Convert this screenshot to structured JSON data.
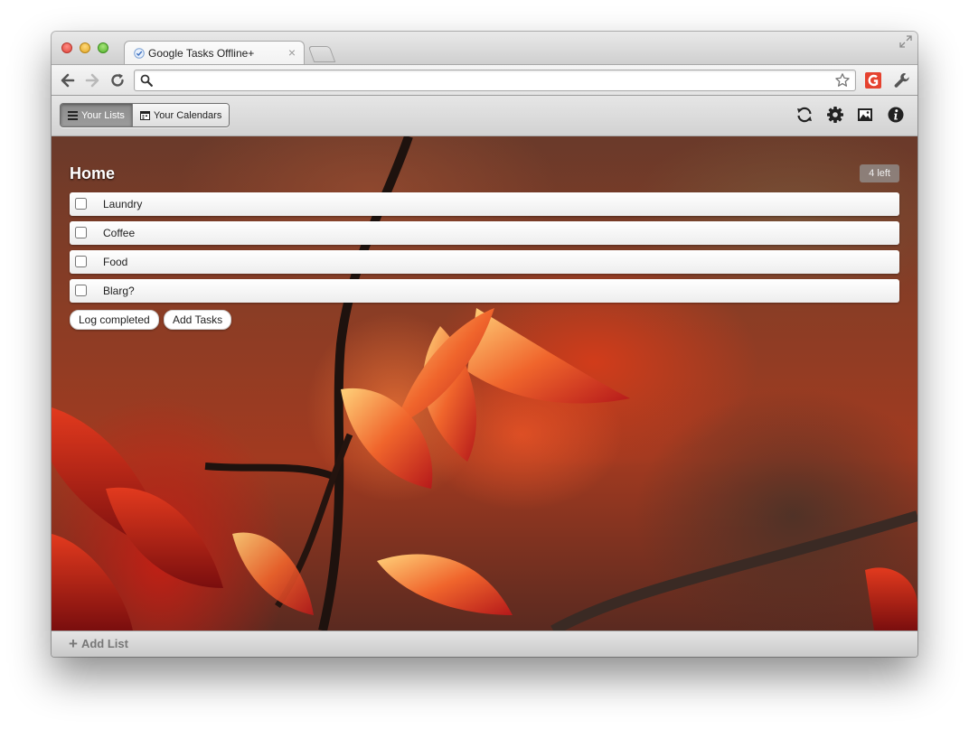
{
  "browser": {
    "tab_title": "Google Tasks Offline+",
    "tab_close_glyph": "×",
    "omnibox_value": "",
    "icons": [
      "back-icon",
      "forward-icon",
      "reload-icon",
      "search-icon",
      "star-icon",
      "extension-icon",
      "wrench-icon",
      "fullscreen-icon"
    ]
  },
  "app": {
    "nav": {
      "lists_label": "Your Lists",
      "calendars_label": "Your Calendars"
    },
    "header_icons": [
      "sync-icon",
      "settings-gear-icon",
      "background-image-icon",
      "info-icon"
    ]
  },
  "list": {
    "title": "Home",
    "remaining": "4 left",
    "tasks": [
      {
        "label": "Laundry",
        "done": false
      },
      {
        "label": "Coffee",
        "done": false
      },
      {
        "label": "Food",
        "done": false
      },
      {
        "label": "Blarg?",
        "done": false
      }
    ],
    "log_completed_label": "Log completed",
    "add_tasks_label": "Add Tasks"
  },
  "footer": {
    "plus_glyph": "+",
    "add_list_label": "Add List"
  }
}
